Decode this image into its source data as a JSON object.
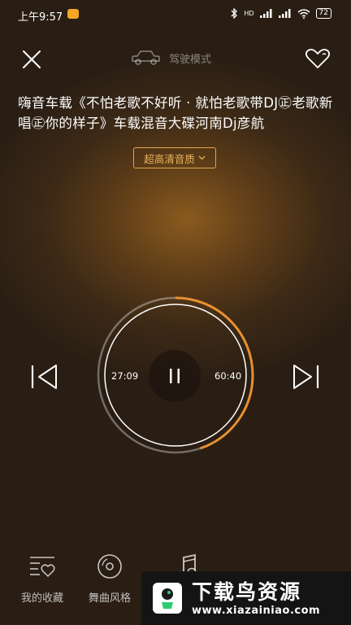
{
  "status": {
    "time": "上午9:57",
    "network": "HD",
    "battery": "72"
  },
  "header": {
    "drive_mode_label": "驾驶模式"
  },
  "song": {
    "title": "嗨音车载《不怕老歌不好听 · 就怕老歌带DJ㊣老歌新唱㊣你的样子》车载混音大碟河南Dj彦航"
  },
  "quality": {
    "label": "超高清音质"
  },
  "player": {
    "current_time": "27:09",
    "total_time": "60:40",
    "progress": 0.4476
  },
  "tabs": [
    {
      "label": "我的收藏",
      "icon": "favorites-icon"
    },
    {
      "label": "舞曲风格",
      "icon": "disc-icon"
    },
    {
      "label": "",
      "icon": "music-note-icon"
    }
  ],
  "watermark": {
    "title": "下载鸟资源",
    "url": "www.xiazainiao.com"
  },
  "colors": {
    "accent": "#e8902f",
    "quality_border": "#e0a84e"
  }
}
